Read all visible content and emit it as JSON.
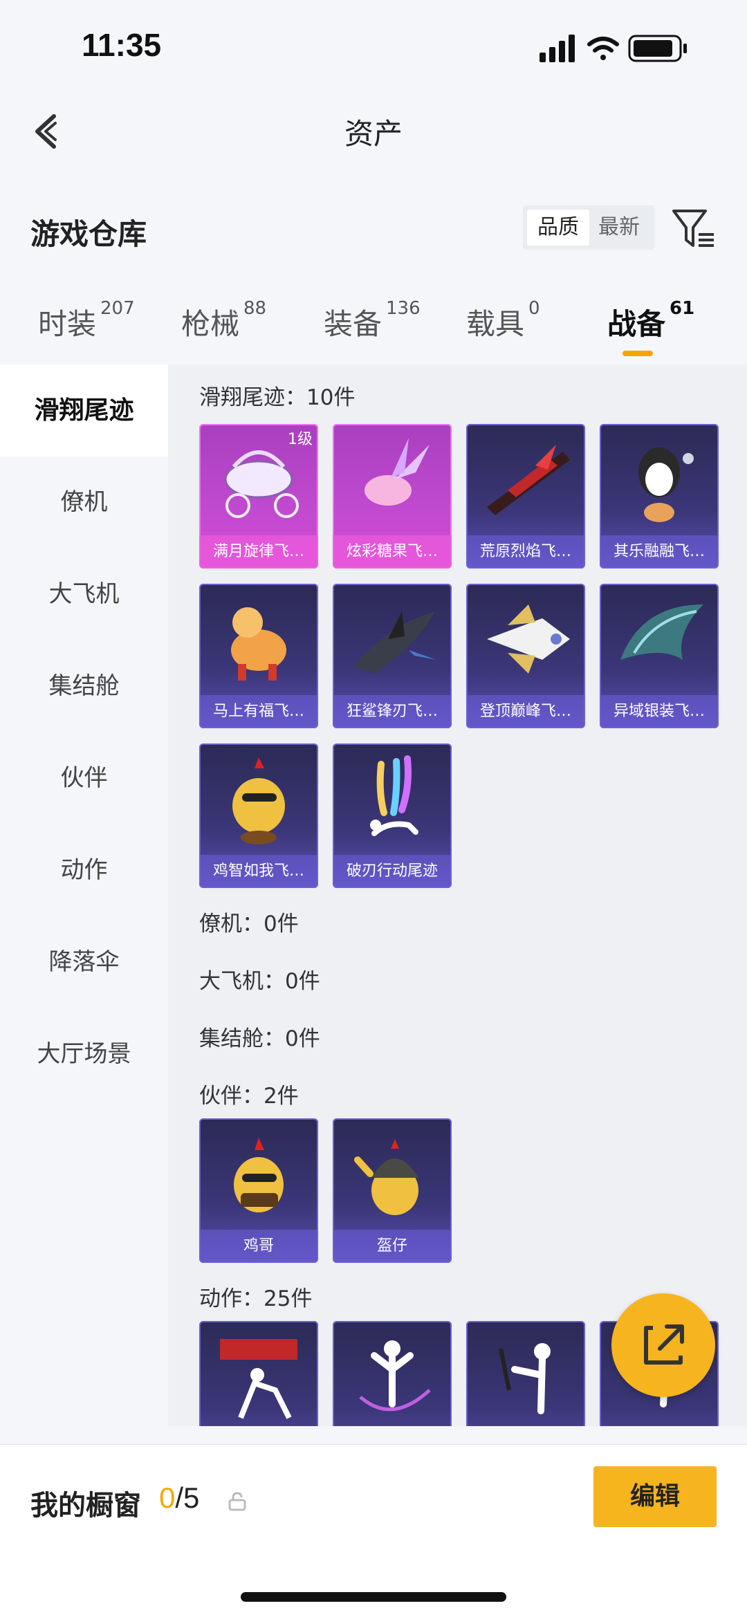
{
  "status": {
    "time": "11:35"
  },
  "nav": {
    "title": "资产"
  },
  "section": {
    "title": "游戏仓库",
    "sort_active": "品质",
    "sort_other": "最新"
  },
  "tabs": [
    {
      "label": "时装",
      "count": "207"
    },
    {
      "label": "枪械",
      "count": "88"
    },
    {
      "label": "装备",
      "count": "136"
    },
    {
      "label": "载具",
      "count": "0"
    },
    {
      "label": "战备",
      "count": "61",
      "active": true
    }
  ],
  "side": [
    "滑翔尾迹",
    "僚机",
    "大飞机",
    "集结舱",
    "伙伴",
    "动作",
    "降落伞",
    "大厅场景"
  ],
  "groups": {
    "glide": {
      "title": "滑翔尾迹：10件",
      "items": [
        "满月旋律飞…",
        "炫彩糖果飞…",
        "荒原烈焰飞…",
        "其乐融融飞…",
        "马上有福飞…",
        "狂鲨锋刃飞…",
        "登顶巅峰飞…",
        "异域银装飞…",
        "鸡智如我飞…",
        "破刃行动尾迹"
      ],
      "level_badge": "1级"
    },
    "wingman": {
      "title": "僚机：0件"
    },
    "bigplane": {
      "title": "大飞机：0件"
    },
    "pod": {
      "title": "集结舱：0件"
    },
    "partner": {
      "title": "伙伴：2件",
      "items": [
        "鸡哥",
        "盔仔"
      ]
    },
    "emote": {
      "title": "动作：25件"
    }
  },
  "window": {
    "title": "我的橱窗",
    "current": "0",
    "max": "/5",
    "edit_label": "编辑"
  },
  "colors": {
    "accent": "#f6b41e",
    "card_purple": "#3b3678",
    "card_pink": "#c14ad0"
  }
}
